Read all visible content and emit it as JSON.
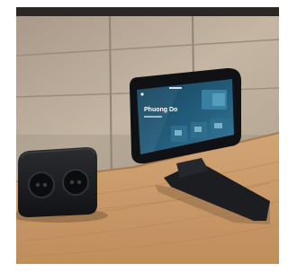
{
  "scene": {
    "subject": "tabletop-touch-panel-and-power-socket",
    "colors": {
      "wall": "#b9aa96",
      "wall_seam": "#8f8373",
      "desk": "#c99a6b",
      "desk_grain": "#b9875a",
      "device_body": "#15171b",
      "screen_bg": "#1f5470",
      "screen_accent": "#3c86a8"
    }
  },
  "touch_panel": {
    "screen": {
      "greeting": "Phuong Do"
    }
  }
}
